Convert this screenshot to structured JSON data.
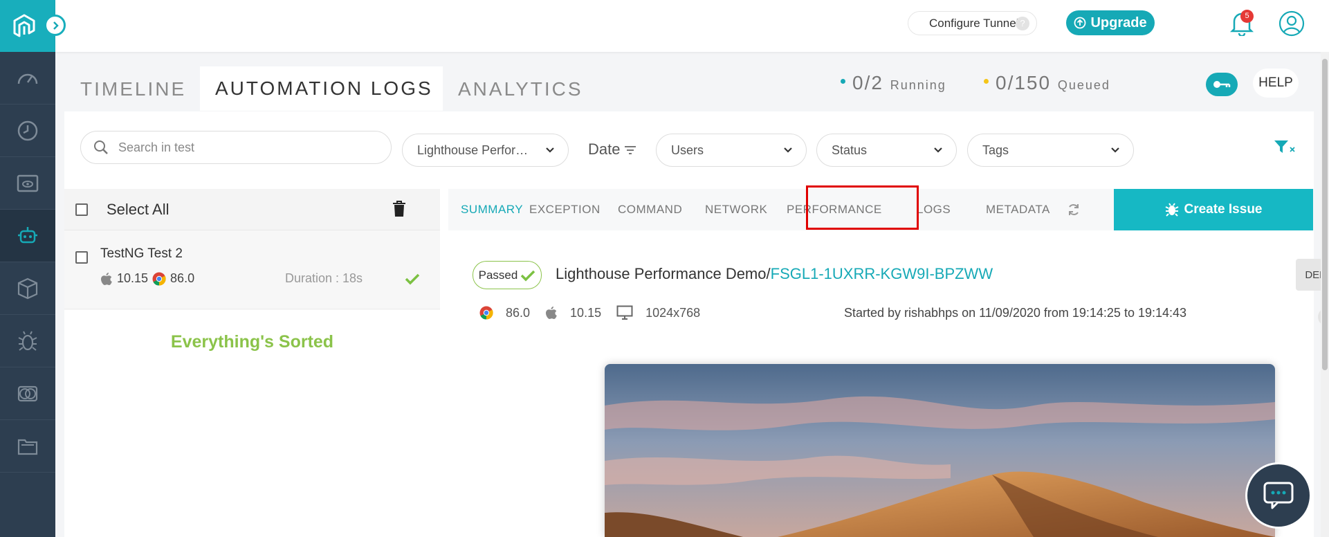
{
  "sidebar": {
    "logo": "lambdatest-logo",
    "items": [
      "dashboard-icon",
      "realtime-clock-icon",
      "visual-ui-icon",
      "automation-robot-icon",
      "package-icon",
      "bug-icon",
      "compare-icon",
      "folder-icon"
    ],
    "active_index": 3
  },
  "topbar": {
    "configure_tunnel": "Configure Tunnel",
    "tunnel_help": "?",
    "upgrade": "Upgrade",
    "notifications_count": "5"
  },
  "main_tabs": [
    {
      "label": "TIMELINE"
    },
    {
      "label": "AUTOMATION LOGS",
      "active": true
    },
    {
      "label": "ANALYTICS"
    }
  ],
  "stats": {
    "running_count": "0/2",
    "running_label": "Running",
    "queued_count": "0/150",
    "queued_label": "Queued"
  },
  "help_label": "HELP",
  "filters": {
    "search_placeholder": "Search in test",
    "build": "Lighthouse Perfor…",
    "date": "Date",
    "users": "Users",
    "status": "Status",
    "tags": "Tags"
  },
  "list": {
    "select_all": "Select All",
    "tests": [
      {
        "name": "TestNG Test 2",
        "os_version": "10.15",
        "browser_version": "86.0",
        "duration": "Duration : 18s"
      }
    ],
    "empty_message": "Everything's Sorted"
  },
  "detail": {
    "tabs": [
      "SUMMARY",
      "EXCEPTION",
      "COMMAND",
      "NETWORK",
      "PERFORMANCE",
      "LOGS",
      "METADATA"
    ],
    "active_tab": "SUMMARY",
    "create_issue": "Create Issue",
    "status_badge": "Passed",
    "build_name": "Lighthouse Performance Demo/",
    "test_id": "FSGL1-1UXRR-KGW9I-BPZWW",
    "delete": "DELETE",
    "browser_version": "86.0",
    "os_version": "10.15",
    "resolution": "1024x768",
    "started_by": "Started by rishabhps on 11/09/2020 from 19:14:25 to 19:14:43"
  },
  "colors": {
    "accent": "#16a9b6",
    "sidebar": "#2d3e50",
    "success": "#8bc34a",
    "highlight": "#e00000"
  }
}
